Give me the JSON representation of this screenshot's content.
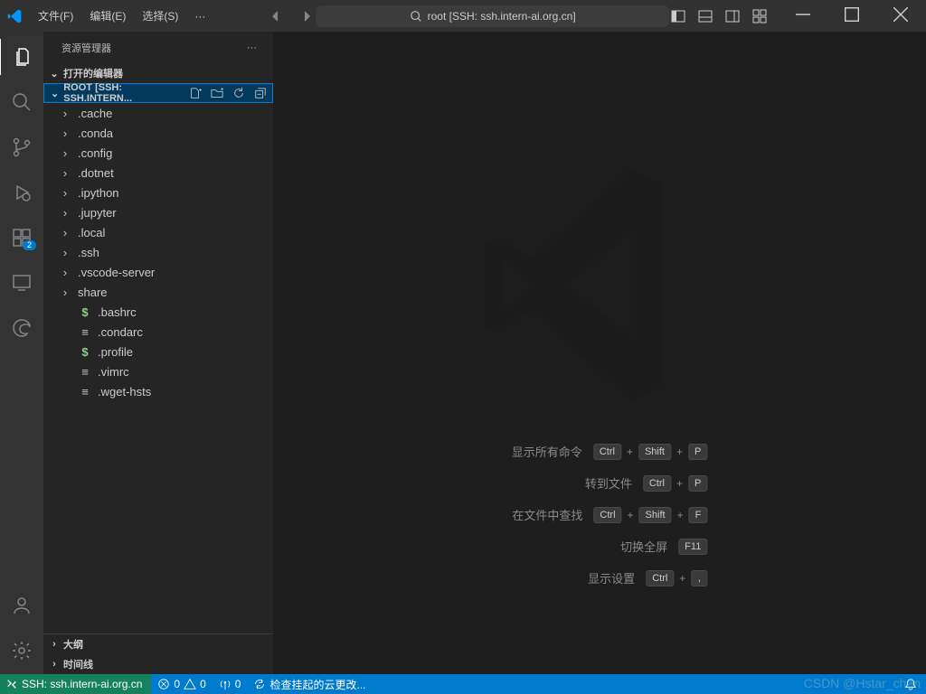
{
  "titlebar": {
    "menu": {
      "file": "文件(F)",
      "edit": "编辑(E)",
      "select": "选择(S)",
      "more": "···"
    },
    "search_text": "root [SSH: ssh.intern-ai.org.cn]"
  },
  "activity": {
    "extensions_badge": "2"
  },
  "sidebar": {
    "title": "资源管理器",
    "sections": {
      "open_editors": "打开的编辑器",
      "workspace": "ROOT [SSH: SSH.INTERN...",
      "outline": "大纲",
      "timeline": "时间线"
    },
    "tree": [
      {
        "name": ".cache",
        "type": "folder"
      },
      {
        "name": ".conda",
        "type": "folder"
      },
      {
        "name": ".config",
        "type": "folder"
      },
      {
        "name": ".dotnet",
        "type": "folder"
      },
      {
        "name": ".ipython",
        "type": "folder"
      },
      {
        "name": ".jupyter",
        "type": "folder"
      },
      {
        "name": ".local",
        "type": "folder"
      },
      {
        "name": ".ssh",
        "type": "folder"
      },
      {
        "name": ".vscode-server",
        "type": "folder"
      },
      {
        "name": "share",
        "type": "folder"
      },
      {
        "name": ".bashrc",
        "type": "file-shell"
      },
      {
        "name": ".condarc",
        "type": "file"
      },
      {
        "name": ".profile",
        "type": "file-shell"
      },
      {
        "name": ".vimrc",
        "type": "file"
      },
      {
        "name": ".wget-hsts",
        "type": "file"
      }
    ]
  },
  "editor": {
    "shortcuts": [
      {
        "label": "显示所有命令",
        "keys": [
          "Ctrl",
          "Shift",
          "P"
        ]
      },
      {
        "label": "转到文件",
        "keys": [
          "Ctrl",
          "P"
        ]
      },
      {
        "label": "在文件中查找",
        "keys": [
          "Ctrl",
          "Shift",
          "F"
        ]
      },
      {
        "label": "切换全屏",
        "keys": [
          "F11"
        ]
      },
      {
        "label": "显示设置",
        "keys": [
          "Ctrl",
          ","
        ]
      }
    ]
  },
  "statusbar": {
    "remote": "SSH: ssh.intern-ai.org.cn",
    "errors": "0",
    "warnings": "0",
    "ports": "0",
    "sync": "检查挂起的云更改..."
  },
  "csdn": "CSDN @Hstar_chen"
}
